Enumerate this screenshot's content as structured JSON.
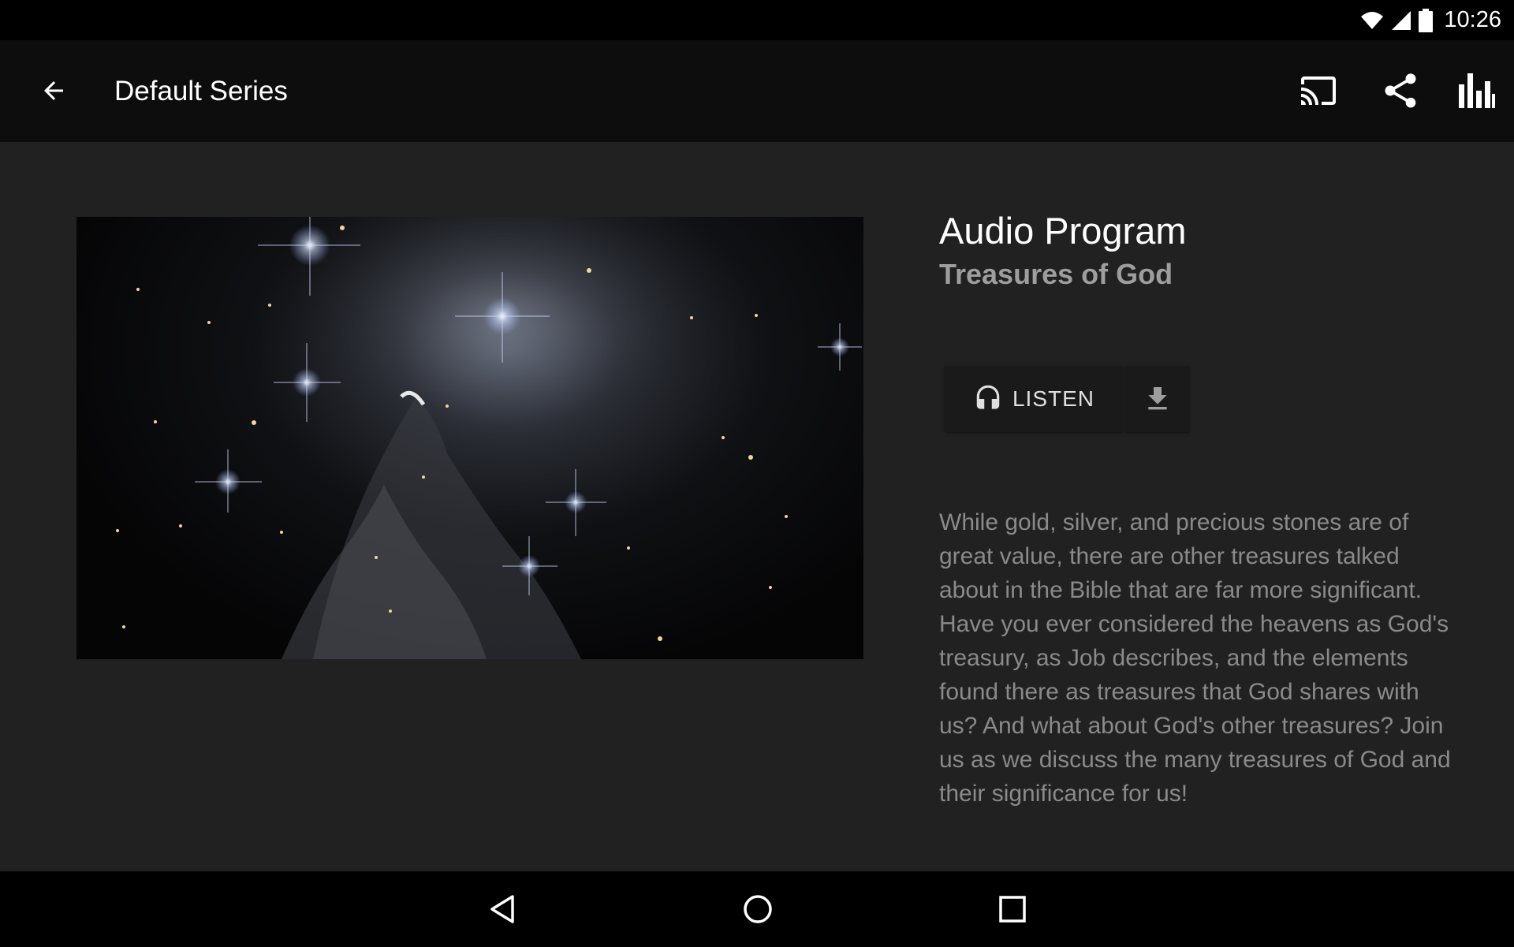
{
  "status_bar": {
    "time": "10:26",
    "icons": [
      "wifi-icon",
      "cell-signal-icon",
      "battery-icon"
    ]
  },
  "app_bar": {
    "title": "Default Series",
    "back_icon": "arrow-back-icon",
    "actions": [
      "cast-icon",
      "share-icon",
      "bar-chart-icon"
    ]
  },
  "program": {
    "type": "Audio Program",
    "title": "Treasures of God",
    "artwork": "starfield-nebula",
    "listen_label": "LISTEN",
    "listen_icon": "headphones-icon",
    "download_icon": "download-icon",
    "description": "While gold, silver, and precious stones are of great value, there are other treasures talked about in the Bible that are far more significant. Have you ever considered the heavens as God's treasury, as Job describes, and the elements found there as treasures that God shares with us? And what about God's other treasures? Join us as we discuss the many treasures of God and their significance for us!"
  },
  "nav_bar": {
    "icons": [
      "nav-back-icon",
      "nav-home-icon",
      "nav-recents-icon"
    ]
  },
  "colors": {
    "background": "#212121",
    "app_bar": "#0d0d0d",
    "status_bar": "#000000",
    "title_text": "#ffffff",
    "subtitle_text": "#9e9e9e",
    "description_text": "#8a8a8a"
  }
}
